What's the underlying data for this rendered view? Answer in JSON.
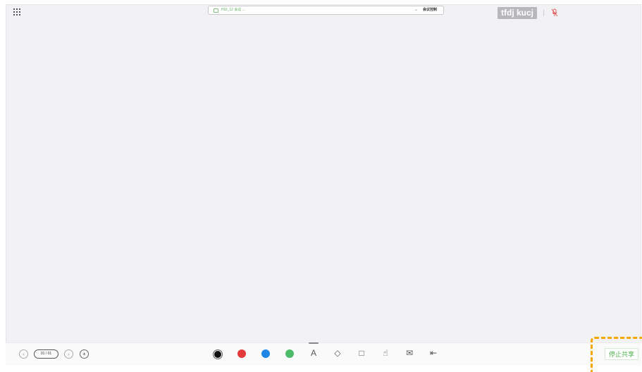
{
  "topbar": {
    "room_name": "HUI_12 会议 ...",
    "chevron": "⌄",
    "control_label": "会议控制",
    "user_name": "tfdj kucj"
  },
  "toolbar": {
    "page_indicator": "01 / 01",
    "prev_glyph": "‹",
    "next_glyph": "›",
    "add_glyph": "+",
    "colors": [
      "#111111",
      "#e33b3b",
      "#1f86e6",
      "#4dbb6a"
    ],
    "tools": {
      "pen": "A",
      "eraser": "◇",
      "rect": "□",
      "hand": "☝",
      "mail": "✉",
      "exit": "⇤"
    },
    "stop_share_label": "停止共享"
  },
  "accent": {
    "highlight": "#f5a700",
    "share_green": "#52b152"
  }
}
